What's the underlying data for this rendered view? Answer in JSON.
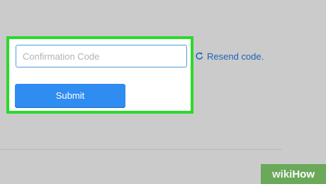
{
  "form": {
    "code_placeholder": "Confirmation Code",
    "code_value": "",
    "submit_label": "Submit",
    "resend_label": "Resend code."
  },
  "watermark": {
    "wiki": "wiki",
    "how": "How"
  },
  "icons": {
    "resend": "refresh-icon"
  },
  "colors": {
    "highlight_border": "#2bd92b",
    "submit_button": "#2f8cf0",
    "resend_link": "#1e63b6",
    "input_border": "#4d9de0",
    "watermark_bg": "#6aa85a"
  }
}
